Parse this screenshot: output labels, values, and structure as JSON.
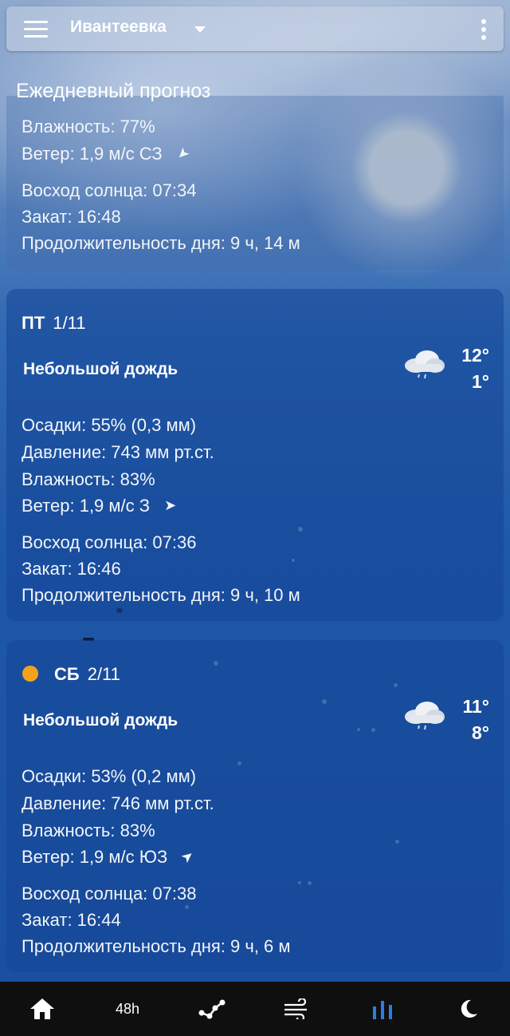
{
  "topbar": {
    "city": "Ивантеевка"
  },
  "section_title": "Ежедневный прогноз",
  "partial_day": {
    "humidity": "Влажность: 77%",
    "wind": "Ветер: 1,9 м/с СЗ",
    "sunrise": "Восход солнца: 07:34",
    "sunset": "Закат: 16:48",
    "day_length": "Продолжительность дня: 9 ч, 14 м"
  },
  "days": [
    {
      "weekday": "ПТ",
      "date": "1/11",
      "condition": "Небольшой дождь",
      "temp_high": "12°",
      "temp_low": "1°",
      "precip": "Осадки: 55% (0,3 мм)",
      "pressure": "Давление: 743 мм рт.ст.",
      "humidity": "Влажность: 83%",
      "wind": "Ветер: 1,9 м/с З",
      "sunrise": "Восход солнца: 07:36",
      "sunset": "Закат: 16:46",
      "day_length": "Продолжительность дня: 9 ч, 10 м",
      "icon": "cloud-rain-icon"
    },
    {
      "weekday": "СБ",
      "date": "2/11",
      "condition": "Небольшой дождь",
      "temp_high": "11°",
      "temp_low": "8°",
      "precip": "Осадки: 53% (0,2 мм)",
      "pressure": "Давление: 746 мм рт.ст.",
      "humidity": "Влажность: 83%",
      "wind": "Ветер: 1,9 м/с ЮЗ",
      "sunrise": "Восход солнца: 07:38",
      "sunset": "Закат: 16:44",
      "day_length": "Продолжительность дня: 9 ч, 6 м",
      "icon": "cloud-rain-icon",
      "marker_color": "#f2a31b"
    }
  ],
  "bottom_nav": {
    "hourly_label": "48h",
    "active_color": "#2f7be0",
    "items": [
      "home-icon",
      "48h",
      "graph-icon",
      "wind-icon",
      "daily-bars-icon",
      "moon-icon"
    ]
  }
}
